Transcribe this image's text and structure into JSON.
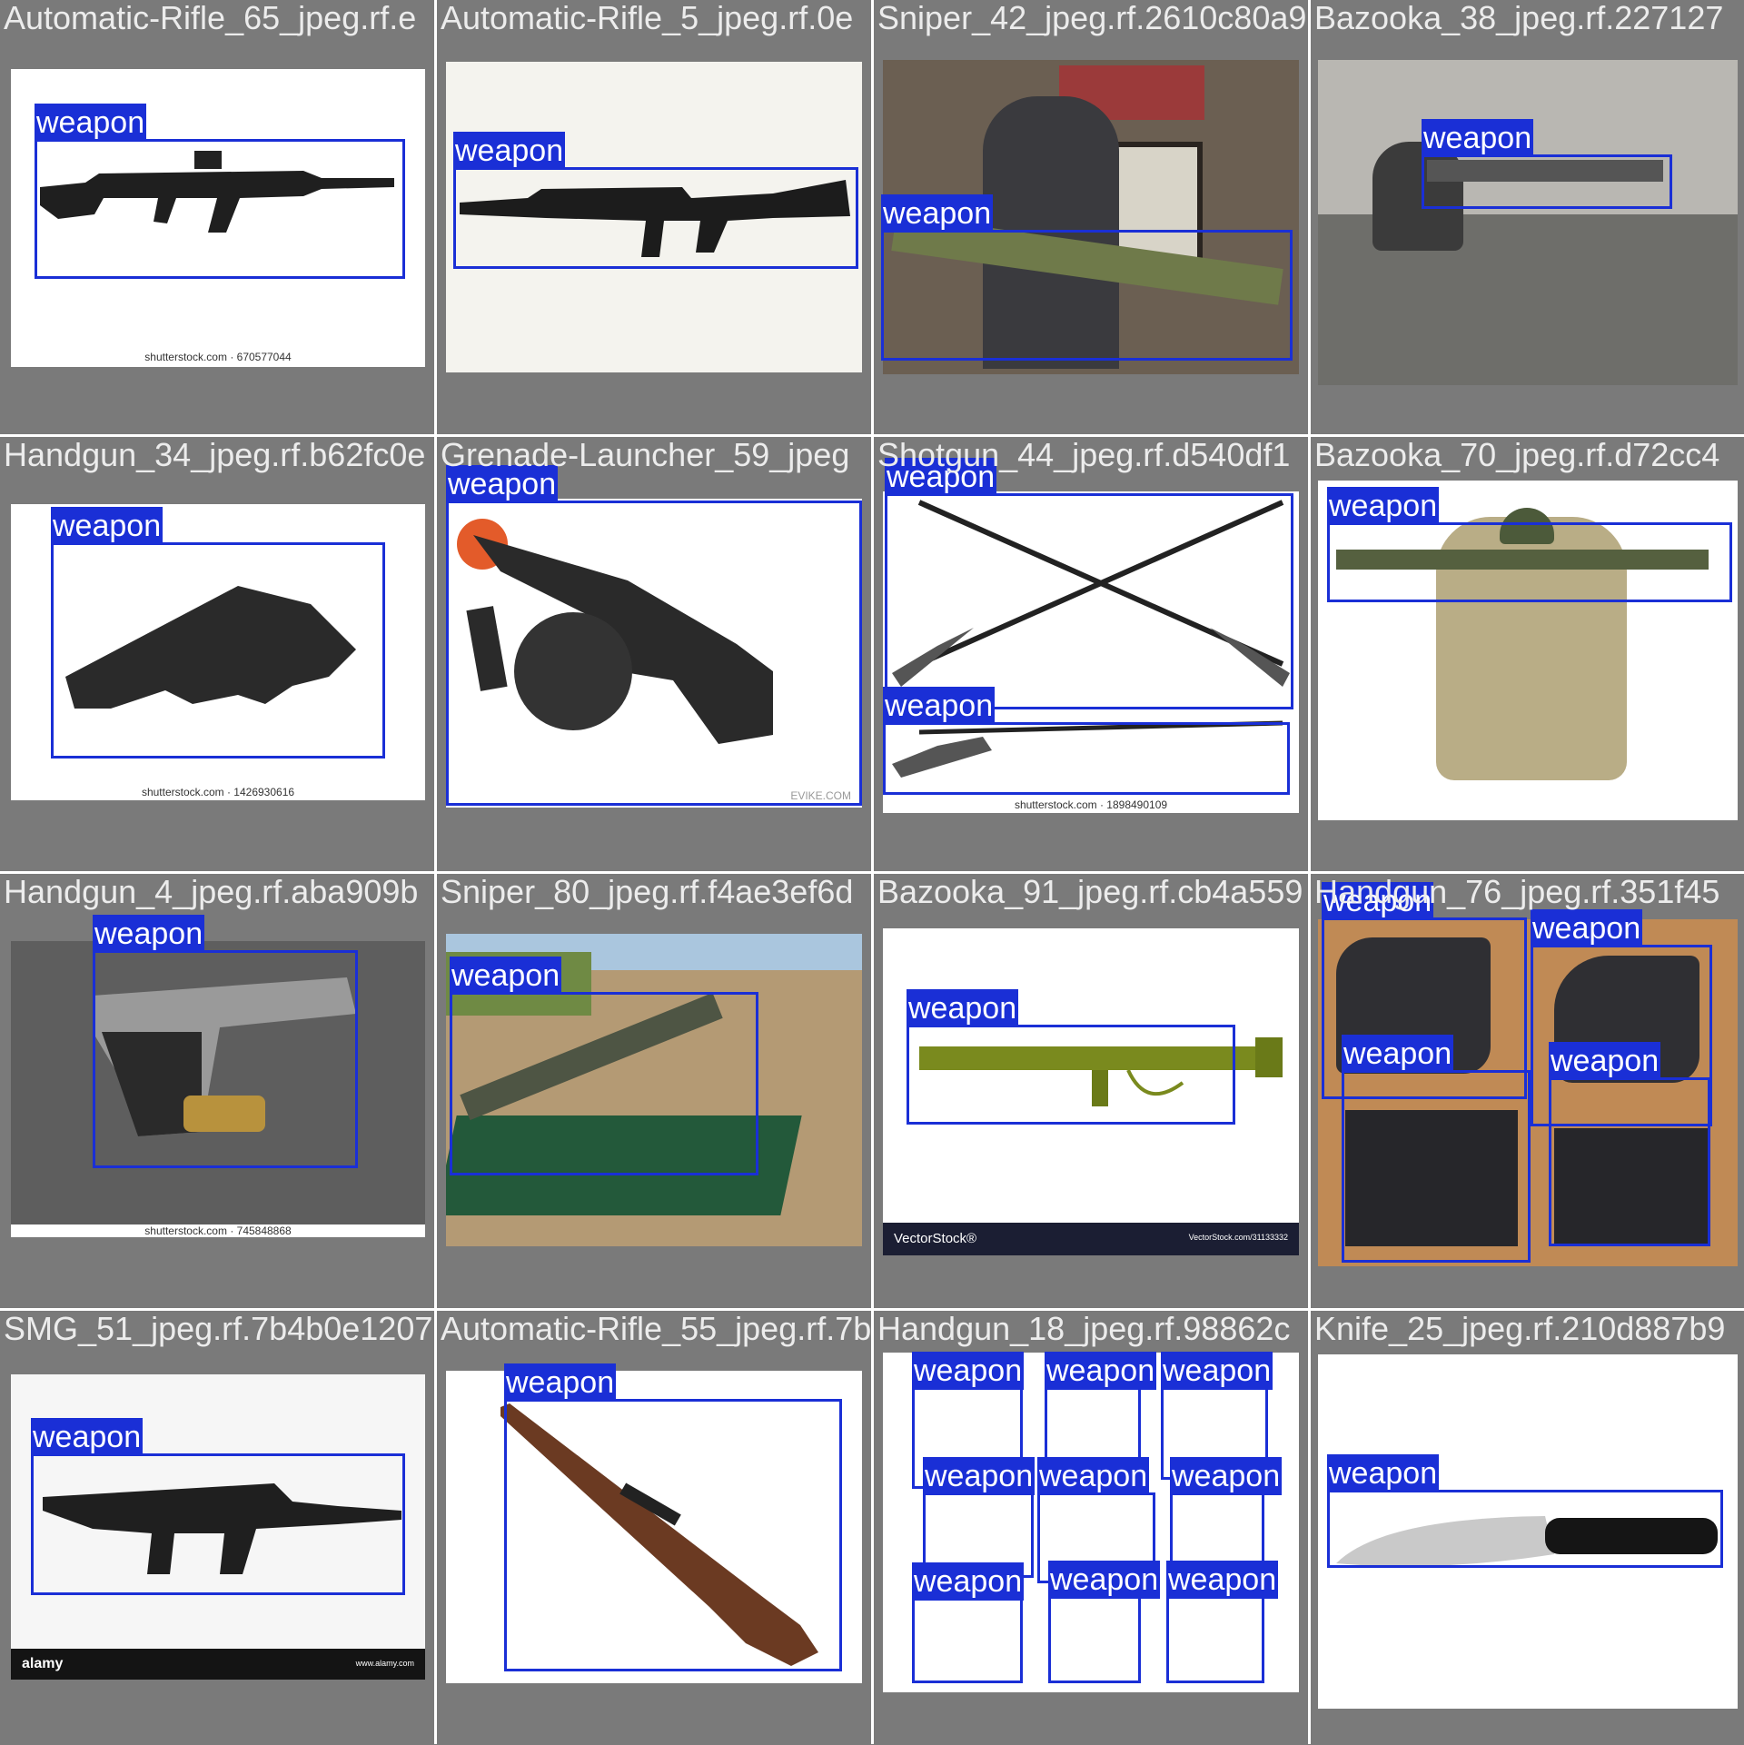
{
  "colors": {
    "grid_bg": "#7a7a7a",
    "box": "#1a2fd6",
    "box_label_text": "#ffffff",
    "caption": "#ececec"
  },
  "tiles": [
    {
      "caption": "Automatic-Rifle_65_jpeg.rf.e",
      "watermark": "shutterstock.com · 670577044",
      "label": "weapon"
    },
    {
      "caption": "Automatic-Rifle_5_jpeg.rf.0e",
      "label": "weapon"
    },
    {
      "caption": "Sniper_42_jpeg.rf.2610c80a9",
      "label": "weapon"
    },
    {
      "caption": "Bazooka_38_jpeg.rf.227127",
      "label": "weapon"
    },
    {
      "caption": "Handgun_34_jpeg.rf.b62fc0e",
      "watermark": "shutterstock.com · 1426930616",
      "label": "weapon"
    },
    {
      "caption": "Grenade-Launcher_59_jpeg",
      "watermark": "EVIKE.COM",
      "label": "weapon"
    },
    {
      "caption": "Shotgun_44_jpeg.rf.d540df1",
      "watermark": "shutterstock.com · 1898490109",
      "label": "weapon"
    },
    {
      "caption": "Bazooka_70_jpeg.rf.d72cc4",
      "label": "weapon"
    },
    {
      "caption": "Handgun_4_jpeg.rf.aba909b",
      "watermark": "shutterstock.com · 745848868",
      "label": "weapon"
    },
    {
      "caption": "Sniper_80_jpeg.rf.f4ae3ef6d",
      "label": "weapon"
    },
    {
      "caption": "Bazooka_91_jpeg.rf.cb4a559",
      "footer_left": "VectorStock®",
      "footer_right": "VectorStock.com/31133332",
      "label": "weapon"
    },
    {
      "caption": "Handgun_76_jpeg.rf.351f45",
      "label": "weapon"
    },
    {
      "caption": "SMG_51_jpeg.rf.7b4b0e1207",
      "footer_left": "alamy",
      "footer_right": "www.alamy.com",
      "label": "weapon"
    },
    {
      "caption": "Automatic-Rifle_55_jpeg.rf.7b",
      "label": "weapon"
    },
    {
      "caption": "Handgun_18_jpeg.rf.98862c",
      "label": "weapon"
    },
    {
      "caption": "Knife_25_jpeg.rf.210d887b9",
      "label": "weapon"
    }
  ]
}
